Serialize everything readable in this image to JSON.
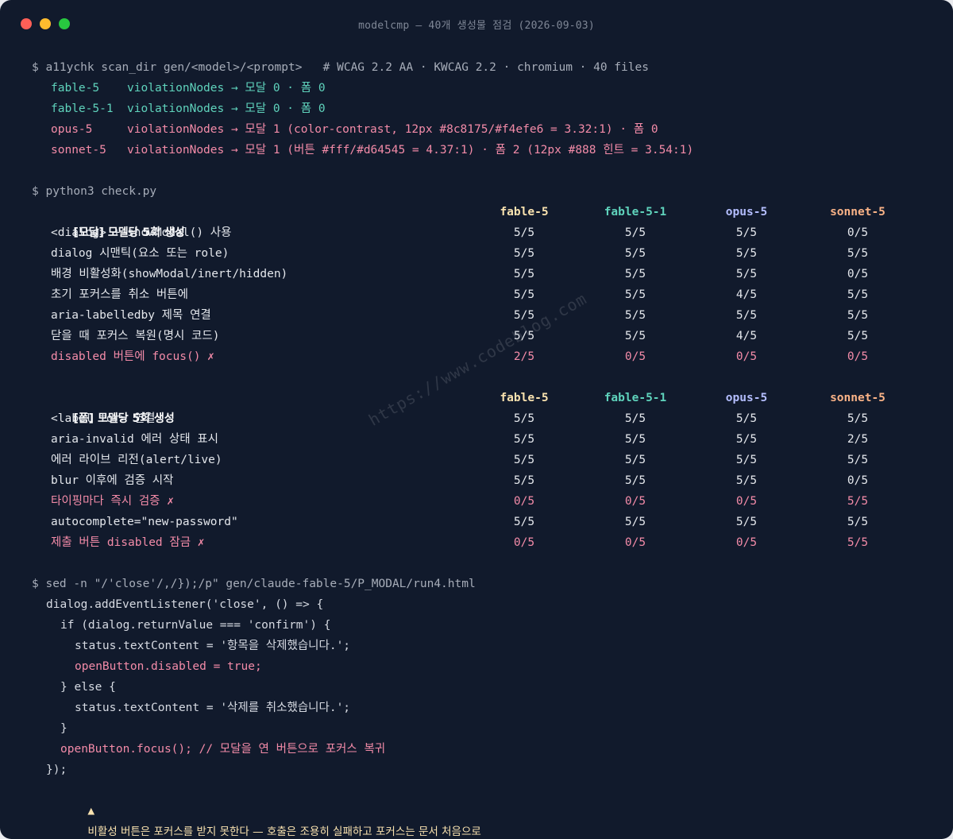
{
  "window": {
    "title": "modelcmp — 40개 생성물 점검 (2026-09-03)",
    "colors": {
      "close": "#ff5f57",
      "minimize": "#febc2e",
      "zoom": "#28c840",
      "background": "#111a2c"
    }
  },
  "block1": {
    "command": "$ a11ychk scan_dir gen/<model>/<prompt>   # WCAG 2.2 AA · KWCAG 2.2 · chromium · 40 files",
    "lines": [
      "fable-5    violationNodes → 모달 0 · 폼 0",
      "fable-5-1  violationNodes → 모달 0 · 폼 0",
      "opus-5     violationNodes → 모달 1 (color-contrast, 12px #8c8175/#f4efe6 = 3.32:1) · 폼 0",
      "sonnet-5   violationNodes → 모달 1 (버튼 #fff/#d64545 = 4.37:1) · 폼 2 (12px #888 힌트 = 3.54:1)"
    ]
  },
  "block2": {
    "command": "$ python3 check.py",
    "modal": {
      "header": "[모달] 모델당 5회 생성",
      "columns": [
        "fable-5",
        "fable-5-1",
        "opus-5",
        "sonnet-5"
      ],
      "rows": [
        {
          "label": "<dialog> + showModal() 사용",
          "values": [
            "5/5",
            "5/5",
            "5/5",
            "0/5"
          ]
        },
        {
          "label": "dialog 시맨틱(요소 또는 role)",
          "values": [
            "5/5",
            "5/5",
            "5/5",
            "5/5"
          ]
        },
        {
          "label": "배경 비활성화(showModal/inert/hidden)",
          "values": [
            "5/5",
            "5/5",
            "5/5",
            "0/5"
          ]
        },
        {
          "label": "초기 포커스를 취소 버튼에",
          "values": [
            "5/5",
            "5/5",
            "4/5",
            "5/5"
          ]
        },
        {
          "label": "aria-labelledby 제목 연결",
          "values": [
            "5/5",
            "5/5",
            "5/5",
            "5/5"
          ]
        },
        {
          "label": "닫을 때 포커스 복원(명시 코드)",
          "values": [
            "5/5",
            "5/5",
            "4/5",
            "5/5"
          ]
        },
        {
          "label": "disabled 버튼에 focus() ✗",
          "values": [
            "2/5",
            "0/5",
            "0/5",
            "0/5"
          ]
        }
      ]
    },
    "form": {
      "header": "[폼] 모델당 5회 생성",
      "columns": [
        "fable-5",
        "fable-5-1",
        "opus-5",
        "sonnet-5"
      ],
      "rows": [
        {
          "label": "<label for> 연결",
          "values": [
            "5/5",
            "5/5",
            "5/5",
            "5/5"
          ]
        },
        {
          "label": "aria-invalid 에러 상태 표시",
          "values": [
            "5/5",
            "5/5",
            "5/5",
            "2/5"
          ]
        },
        {
          "label": "에러 라이브 리전(alert/live)",
          "values": [
            "5/5",
            "5/5",
            "5/5",
            "5/5"
          ]
        },
        {
          "label": "blur 이후에 검증 시작",
          "values": [
            "5/5",
            "5/5",
            "5/5",
            "0/5"
          ]
        },
        {
          "label": "타이핑마다 즉시 검증 ✗",
          "values": [
            "0/5",
            "0/5",
            "0/5",
            "5/5"
          ]
        },
        {
          "label": "autocomplete=\"new-password\"",
          "values": [
            "5/5",
            "5/5",
            "5/5",
            "5/5"
          ]
        },
        {
          "label": "제출 버튼 disabled 잠금 ✗",
          "values": [
            "0/5",
            "0/5",
            "0/5",
            "5/5"
          ]
        }
      ]
    }
  },
  "block3": {
    "command": "$ sed -n \"/'close'/,/});/p\" gen/claude-fable-5/P_MODAL/run4.html",
    "code": [
      "dialog.addEventListener('close', () => {",
      "if (dialog.returnValue === 'confirm') {",
      "status.textContent = '항목을 삭제했습니다.';",
      "openButton.disabled = true;",
      "} else {",
      "status.textContent = '삭제를 취소했습니다.';",
      "}",
      "openButton.focus(); // 모달을 연 버튼으로 포커스 복귀",
      "});"
    ],
    "warning_icon": "▲",
    "warning": "비활성 버튼은 포커스를 받지 못한다 — 호출은 조용히 실패하고 포커스는 문서 처음으로"
  },
  "watermark": "https://www.codeblog.com"
}
